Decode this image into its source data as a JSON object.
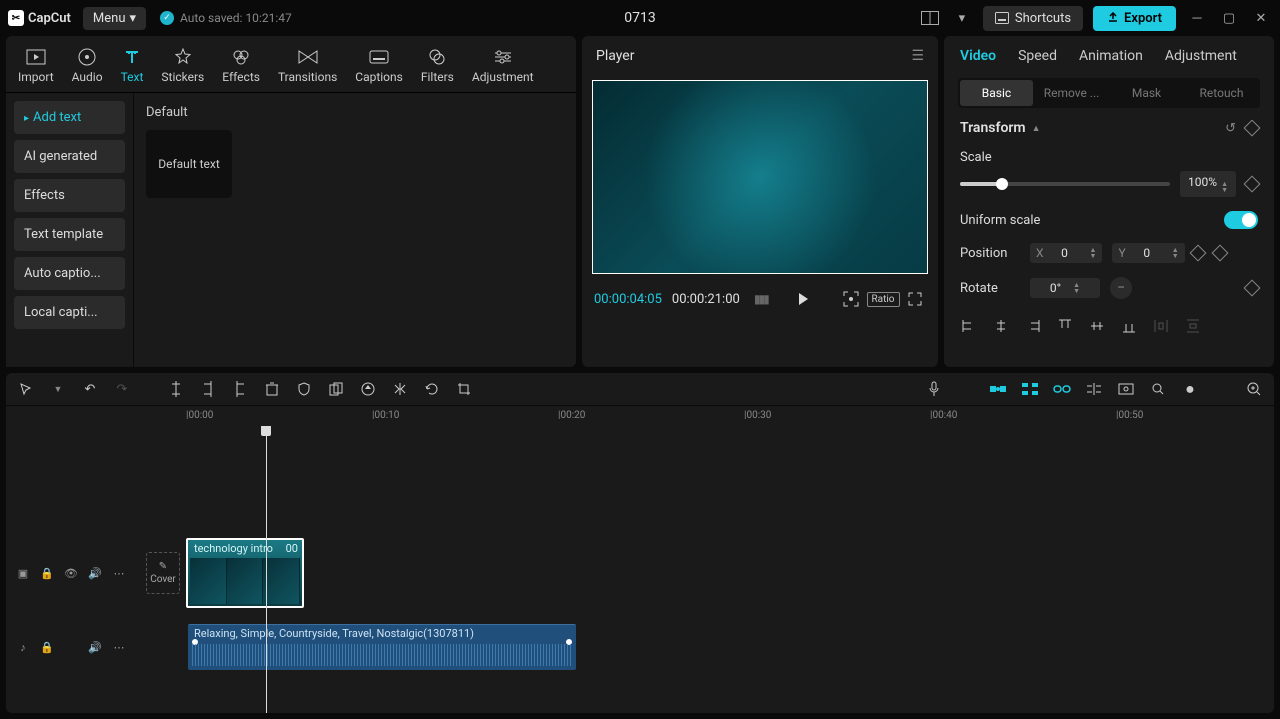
{
  "app_name": "CapCut",
  "menu_label": "Menu",
  "autosave": "Auto saved: 10:21:47",
  "project_title": "0713",
  "shortcuts_label": "Shortcuts",
  "export_label": "Export",
  "toolbar": {
    "tabs": [
      {
        "label": "Import"
      },
      {
        "label": "Audio"
      },
      {
        "label": "Text"
      },
      {
        "label": "Stickers"
      },
      {
        "label": "Effects"
      },
      {
        "label": "Transitions"
      },
      {
        "label": "Captions"
      },
      {
        "label": "Filters"
      },
      {
        "label": "Adjustment"
      }
    ]
  },
  "sidebar": {
    "items": [
      {
        "label": "Add text"
      },
      {
        "label": "AI generated"
      },
      {
        "label": "Effects"
      },
      {
        "label": "Text template"
      },
      {
        "label": "Auto captio..."
      },
      {
        "label": "Local capti..."
      }
    ]
  },
  "content": {
    "section": "Default",
    "thumb_label": "Default text"
  },
  "player": {
    "title": "Player",
    "current": "00:00:04:05",
    "total": "00:00:21:00",
    "ratio": "Ratio"
  },
  "props": {
    "tabs": [
      "Video",
      "Speed",
      "Animation",
      "Adjustment"
    ],
    "subtabs": [
      "Basic",
      "Remove ...",
      "Mask",
      "Retouch"
    ],
    "transform": "Transform",
    "scale_label": "Scale",
    "scale_value": "100%",
    "uniform": "Uniform scale",
    "position": "Position",
    "pos_x_label": "X",
    "pos_x": "0",
    "pos_y_label": "Y",
    "pos_y": "0",
    "rotate": "Rotate",
    "rotate_val": "0°"
  },
  "timeline": {
    "ticks": [
      "00:00",
      "00:10",
      "00:20",
      "00:30",
      "00:40",
      "00:50"
    ],
    "cover": "Cover",
    "clip_name": "technology intro",
    "clip_tc": "00",
    "audio_name": "Relaxing, Simple, Countryside, Travel, Nostalgic(1307811)"
  }
}
